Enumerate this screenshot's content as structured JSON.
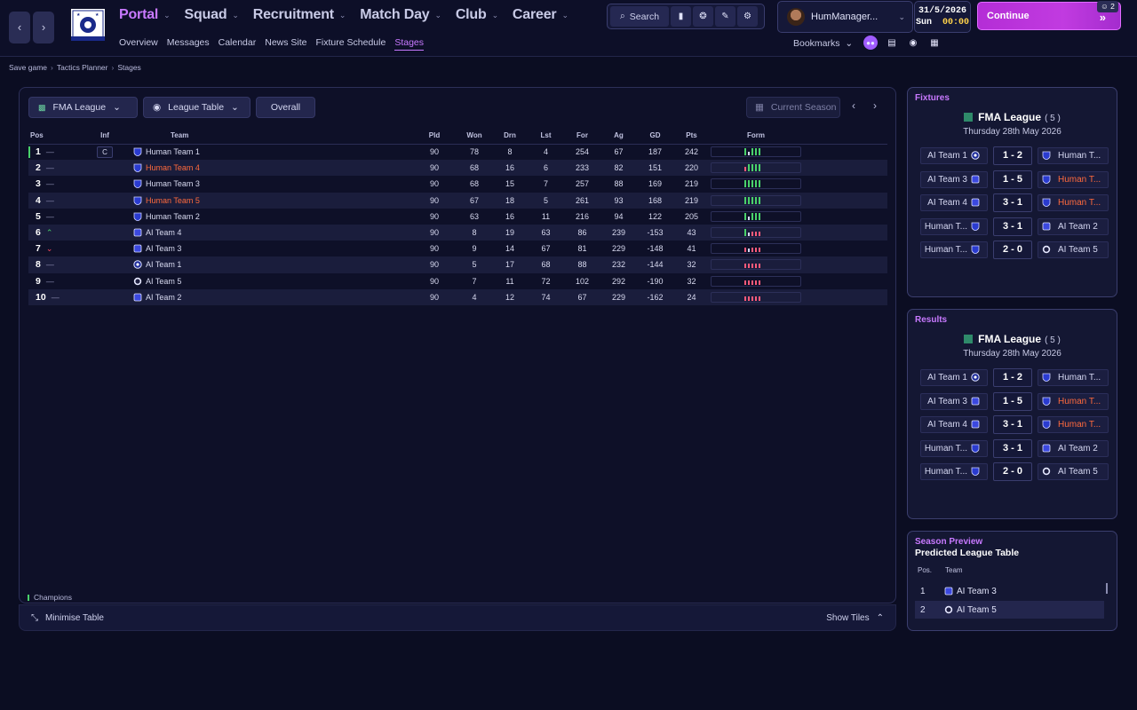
{
  "nav": {
    "main": [
      {
        "label": "Portal",
        "active": true
      },
      {
        "label": "Squad",
        "active": false
      },
      {
        "label": "Recruitment",
        "active": false
      },
      {
        "label": "Match Day",
        "active": false
      },
      {
        "label": "Club",
        "active": false
      },
      {
        "label": "Career",
        "active": false
      }
    ],
    "sub": [
      {
        "label": "Overview",
        "active": false
      },
      {
        "label": "Messages",
        "active": false
      },
      {
        "label": "Calendar",
        "active": false
      },
      {
        "label": "News Site",
        "active": false
      },
      {
        "label": "Fixture Schedule",
        "active": false
      },
      {
        "label": "Stages",
        "active": true
      }
    ],
    "back_icon": "chevron-left-icon",
    "forward_icon": "chevron-right-icon"
  },
  "toolbar": {
    "search_label": "Search"
  },
  "user": {
    "name": "HumManager..."
  },
  "date": {
    "date": "31/5/2026",
    "day": "Sun",
    "time": "00:00"
  },
  "continue": {
    "label": "Continue"
  },
  "notifications": {
    "count": "2"
  },
  "bookmarks": {
    "label": "Bookmarks"
  },
  "breadcrumb": [
    "Save game",
    "Tactics Planner",
    "Stages"
  ],
  "filters": {
    "competition": "FMA League",
    "view": "League Table",
    "scope": "Overall",
    "season": "Current Season"
  },
  "table": {
    "headers": {
      "pos": "Pos",
      "inf": "Inf",
      "team": "Team",
      "pld": "Pld",
      "won": "Won",
      "drn": "Drn",
      "lst": "Lst",
      "for": "For",
      "ag": "Ag",
      "gd": "GD",
      "pts": "Pts",
      "form": "Form"
    },
    "rows": [
      {
        "pos": "1",
        "move": "—",
        "inf": "C",
        "team": "Human Team 1",
        "highlight": false,
        "pld": "90",
        "won": "78",
        "drn": "8",
        "lst": "4",
        "for": "254",
        "ag": "67",
        "gd": "187",
        "pts": "242",
        "form": [
          "w",
          "d",
          "w",
          "w",
          "w"
        ],
        "champion": true
      },
      {
        "pos": "2",
        "move": "—",
        "inf": "",
        "team": "Human Team 4",
        "highlight": true,
        "pld": "90",
        "won": "68",
        "drn": "16",
        "lst": "6",
        "for": "233",
        "ag": "82",
        "gd": "151",
        "pts": "220",
        "form": [
          "l",
          "w",
          "w",
          "w",
          "w"
        ],
        "champion": false
      },
      {
        "pos": "3",
        "move": "—",
        "inf": "",
        "team": "Human Team 3",
        "highlight": false,
        "pld": "90",
        "won": "68",
        "drn": "15",
        "lst": "7",
        "for": "257",
        "ag": "88",
        "gd": "169",
        "pts": "219",
        "form": [
          "w",
          "w",
          "w",
          "w",
          "w"
        ],
        "champion": false
      },
      {
        "pos": "4",
        "move": "—",
        "inf": "",
        "team": "Human Team 5",
        "highlight": true,
        "pld": "90",
        "won": "67",
        "drn": "18",
        "lst": "5",
        "for": "261",
        "ag": "93",
        "gd": "168",
        "pts": "219",
        "form": [
          "w",
          "w",
          "w",
          "w",
          "w"
        ],
        "champion": false
      },
      {
        "pos": "5",
        "move": "—",
        "inf": "",
        "team": "Human Team 2",
        "highlight": false,
        "pld": "90",
        "won": "63",
        "drn": "16",
        "lst": "11",
        "for": "216",
        "ag": "94",
        "gd": "122",
        "pts": "205",
        "form": [
          "w",
          "d",
          "w",
          "w",
          "w"
        ],
        "champion": false
      },
      {
        "pos": "6",
        "move": "up",
        "inf": "",
        "team": "AI Team 4",
        "highlight": false,
        "pld": "90",
        "won": "8",
        "drn": "19",
        "lst": "63",
        "for": "86",
        "ag": "239",
        "gd": "-153",
        "pts": "43",
        "form": [
          "w",
          "d",
          "l",
          "l",
          "l"
        ],
        "champion": false
      },
      {
        "pos": "7",
        "move": "down",
        "inf": "",
        "team": "AI Team 3",
        "highlight": false,
        "pld": "90",
        "won": "9",
        "drn": "14",
        "lst": "67",
        "for": "81",
        "ag": "229",
        "gd": "-148",
        "pts": "41",
        "form": [
          "l",
          "d",
          "l",
          "l",
          "l"
        ],
        "champion": false
      },
      {
        "pos": "8",
        "move": "—",
        "inf": "",
        "team": "AI Team 1",
        "highlight": false,
        "pld": "90",
        "won": "5",
        "drn": "17",
        "lst": "68",
        "for": "88",
        "ag": "232",
        "gd": "-144",
        "pts": "32",
        "form": [
          "l",
          "l",
          "l",
          "l",
          "l"
        ],
        "champion": false
      },
      {
        "pos": "9",
        "move": "—",
        "inf": "",
        "team": "AI Team 5",
        "highlight": false,
        "pld": "90",
        "won": "7",
        "drn": "11",
        "lst": "72",
        "for": "102",
        "ag": "292",
        "gd": "-190",
        "pts": "32",
        "form": [
          "l",
          "l",
          "l",
          "l",
          "l"
        ],
        "champion": false
      },
      {
        "pos": "10",
        "move": "—",
        "inf": "",
        "team": "AI Team 2",
        "highlight": false,
        "pld": "90",
        "won": "4",
        "drn": "12",
        "lst": "74",
        "for": "67",
        "ag": "229",
        "gd": "-162",
        "pts": "24",
        "form": [
          "l",
          "l",
          "l",
          "l",
          "l"
        ],
        "champion": false
      }
    ]
  },
  "legend": {
    "champions": "Champions"
  },
  "bottom": {
    "minimise": "Minimise Table",
    "show_tiles": "Show Tiles"
  },
  "fixtures": {
    "title": "Fixtures",
    "league": "FMA League",
    "count": "( 5 )",
    "date": "Thursday 28th May 2026",
    "matches": [
      {
        "home": "AI Team 1",
        "home_hl": false,
        "score": "1 - 2",
        "away": "Human T...",
        "away_hl": false
      },
      {
        "home": "AI Team 3",
        "home_hl": false,
        "score": "1 - 5",
        "away": "Human T...",
        "away_hl": true
      },
      {
        "home": "AI Team 4",
        "home_hl": false,
        "score": "3 - 1",
        "away": "Human T...",
        "away_hl": true
      },
      {
        "home": "Human T...",
        "home_hl": false,
        "score": "3 - 1",
        "away": "AI Team 2",
        "away_hl": false
      },
      {
        "home": "Human T...",
        "home_hl": false,
        "score": "2 - 0",
        "away": "AI Team 5",
        "away_hl": false
      }
    ]
  },
  "results": {
    "title": "Results",
    "league": "FMA League",
    "count": "( 5 )",
    "date": "Thursday 28th May 2026",
    "matches": [
      {
        "home": "AI Team 1",
        "home_hl": false,
        "score": "1 - 2",
        "away": "Human T...",
        "away_hl": false
      },
      {
        "home": "AI Team 3",
        "home_hl": false,
        "score": "1 - 5",
        "away": "Human T...",
        "away_hl": true
      },
      {
        "home": "AI Team 4",
        "home_hl": false,
        "score": "3 - 1",
        "away": "Human T...",
        "away_hl": true
      },
      {
        "home": "Human T...",
        "home_hl": false,
        "score": "3 - 1",
        "away": "AI Team 2",
        "away_hl": false
      },
      {
        "home": "Human T...",
        "home_hl": false,
        "score": "2 - 0",
        "away": "AI Team 5",
        "away_hl": false
      }
    ]
  },
  "preview": {
    "title": "Season Preview",
    "subtitle": "Predicted League Table",
    "headers": {
      "pos": "Pos.",
      "team": "Team"
    },
    "rows": [
      {
        "pos": "1",
        "team": "AI Team 3"
      },
      {
        "pos": "2",
        "team": "AI Team 5"
      }
    ]
  },
  "colors": {
    "accent": "#c879ff",
    "highlight_team": "#ff6a3d",
    "win": "#49d16a",
    "loss": "#ff5a7a",
    "continue": "#c13be0"
  }
}
